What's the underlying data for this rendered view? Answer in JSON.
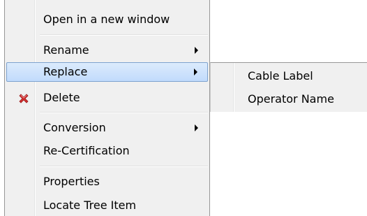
{
  "menu": {
    "items": [
      {
        "label": "Open in a new window"
      },
      {
        "label": "Rename"
      },
      {
        "label": "Replace"
      },
      {
        "label": "Delete"
      },
      {
        "label": "Conversion"
      },
      {
        "label": "Re-Certification"
      },
      {
        "label": "Properties"
      },
      {
        "label": "Locate Tree Item"
      }
    ],
    "icons": {
      "delete": "delete-x-icon",
      "submenu_arrow": "chevron-right-icon"
    },
    "colors": {
      "highlight": "#c1dbfc",
      "highlight_border": "#7da2ce",
      "delete_icon": "#d32f2f",
      "background": "#f0f0f0"
    }
  },
  "submenu": {
    "items": [
      {
        "label": "Cable Label"
      },
      {
        "label": "Operator Name"
      }
    ]
  }
}
